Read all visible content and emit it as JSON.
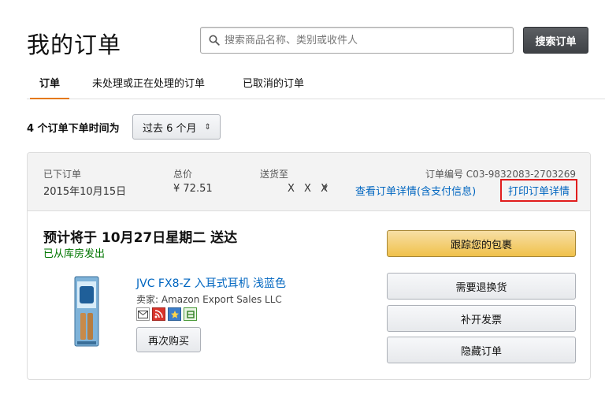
{
  "page": {
    "title": "我的订单"
  },
  "search": {
    "placeholder": "搜索商品名称、类别或收件人",
    "button_label": "搜索订单"
  },
  "tabs": [
    {
      "label": "订单",
      "active": true
    },
    {
      "label": "未处理或正在处理的订单",
      "active": false
    },
    {
      "label": "已取消的订单",
      "active": false
    }
  ],
  "filter": {
    "summary": "4 个订单下单时间为",
    "period": "过去 6 个月"
  },
  "order": {
    "placed_label": "已下订单",
    "placed_date": "2015年10月15日",
    "total_label": "总价",
    "total_value": "¥ 72.51",
    "ship_to_label": "送货至",
    "ship_to_value": "X X X",
    "order_number": "订单编号 C03-9832083-2703269",
    "detail_link": "查看订单详情(含支付信息)",
    "print_link": "打印订单详情",
    "delivery_title": "预计将于 10月27日星期二 送达",
    "delivery_status": "已从库房发出",
    "product_title": "JVC FX8-Z 入耳式耳机 浅蓝色",
    "seller": "卖家: Amazon Export Sales LLC",
    "rebuy_label": "再次购买",
    "actions": {
      "track": "跟踪您的包裹",
      "return": "需要退换货",
      "invoice": "补开发票",
      "hide": "隐藏订单"
    }
  },
  "colors": {
    "accent": "#e47911",
    "link": "#0066c0",
    "status_green": "#007600",
    "highlight_red": "#e11d1d",
    "primary_button": "#f0c14b"
  }
}
